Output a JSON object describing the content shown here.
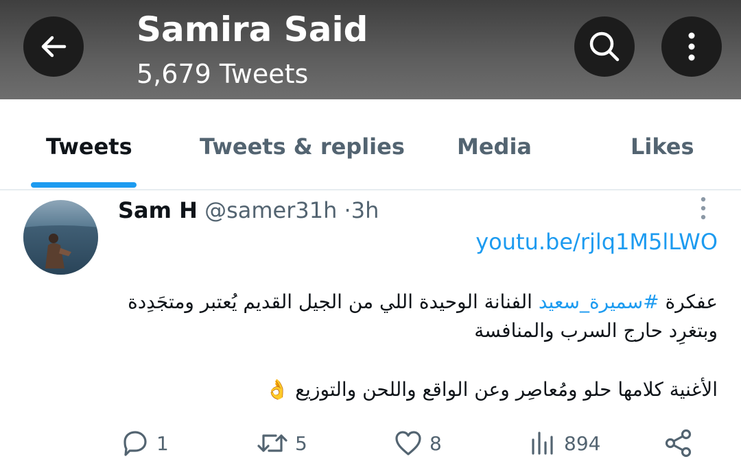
{
  "header": {
    "title": "Samira Said",
    "subtitle": "5,679 Tweets",
    "back_icon": "arrow-left-icon",
    "search_icon": "search-icon",
    "more_icon": "more-vertical-icon"
  },
  "tabs": [
    {
      "label": "Tweets",
      "active": true
    },
    {
      "label": "Tweets & replies",
      "active": false
    },
    {
      "label": "Media",
      "active": false
    },
    {
      "label": "Likes",
      "active": false
    }
  ],
  "tweet": {
    "author": "Sam H",
    "handle": "@samer31h",
    "separator": "·",
    "time": "3h",
    "link": "youtu.be/rjlq1M5lLWO",
    "line1_before": "عفكرة ",
    "hashtag": "#سميرة_سعيد",
    "line1_after": " الفنانة الوحيدة اللي من الجيل القديم يُعتبر ومتجَدِدة وبتغرِد حارج السرب والمنافسة",
    "line2": "الأغنية كلامها حلو ومُعاصِر  وعن الواقع واللحن والتوزيع 👌",
    "actions": {
      "replies": "1",
      "retweets": "5",
      "likes": "8",
      "views": "894"
    }
  },
  "colors": {
    "accent": "#1d9bf0",
    "secondary_text": "#536471",
    "header_bg": "#5a5a5a"
  }
}
